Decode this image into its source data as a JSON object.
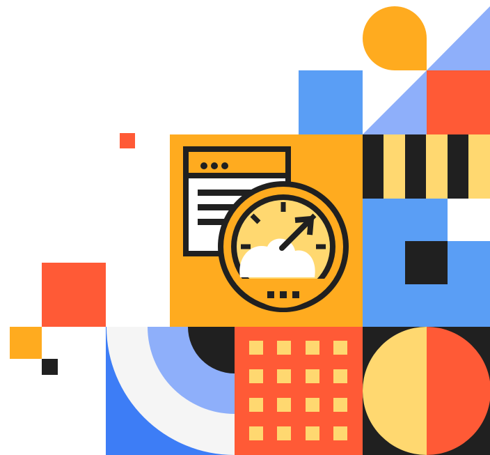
{
  "illustration": {
    "subject": "speedometer-over-document-icon",
    "palette": {
      "orange": "#FFAB1F",
      "red_orange": "#FF5A36",
      "blue": "#5A9EF5",
      "light_blue": "#8EAFFA",
      "bright_blue": "#3D7DF6",
      "pale_yellow": "#FFD870",
      "black": "#202020",
      "off_white": "#F5F5F5",
      "white": "#FFFFFF"
    },
    "icons": [
      "browser-window-icon",
      "speedometer-icon",
      "gauge-needle-arrow-icon"
    ]
  }
}
